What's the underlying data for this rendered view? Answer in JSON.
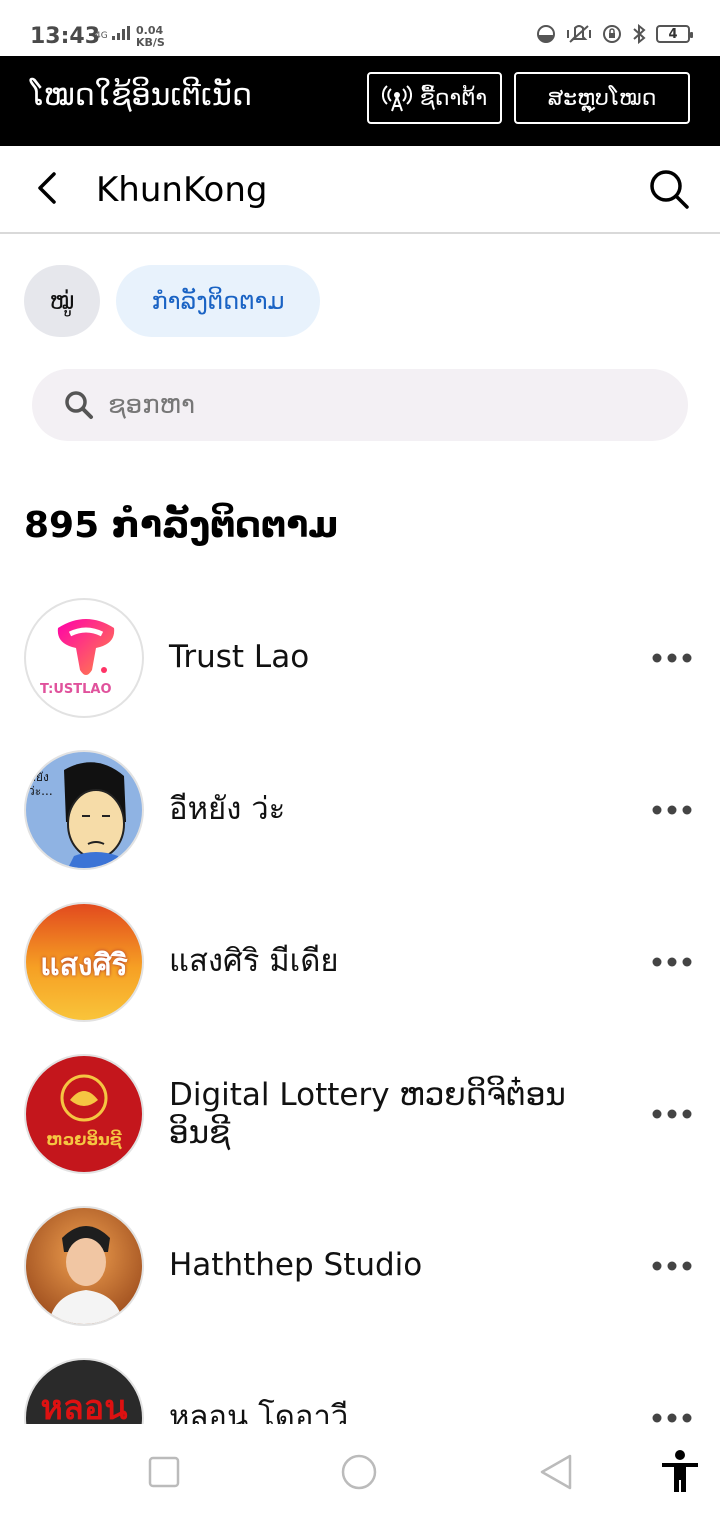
{
  "status_bar": {
    "time": "13:43",
    "network": "4G",
    "speed_value": "0.04",
    "speed_unit": "KB/S",
    "battery": "4"
  },
  "data_banner": {
    "title": "ໂໝດໃຊ້ອິນເຕີເນັດ",
    "buy_data_label": "ຊື້ດາຕ້າ",
    "summary_label": "ສະຫຼຸບໂໝດ"
  },
  "header": {
    "title": "KhunKong"
  },
  "chips": {
    "groups_label": "ໝູ່",
    "following_label": "ກຳລັງຕິດຕາມ"
  },
  "search": {
    "placeholder": "ຊອກຫາ"
  },
  "following_count": "895 ກຳລັງຕິດຕາມ",
  "list": [
    {
      "name": "Trust Lao",
      "avatar_text": "T:USTLAO"
    },
    {
      "name": "อีหยัง ว่ะ",
      "avatar_text": "หยัง ว่ะ..."
    },
    {
      "name": "แสงศิริ มีเดีย",
      "avatar_text": "แสงศิริ"
    },
    {
      "name": "Digital Lottery ຫວຍດິຈິຕ໋ອນ ອິນຊີ",
      "avatar_text": "ຫວຍອິນຊີ"
    },
    {
      "name": "Haththep Studio",
      "avatar_text": ""
    },
    {
      "name": "หลอน โดอาวี",
      "avatar_text": "หลอน"
    }
  ],
  "colors": {
    "banner_bg": "#000000",
    "accent_blue": "#1a63c4",
    "chip_following_bg": "#e8f2fc",
    "chip_groups_bg": "#e6e7ec",
    "search_bg": "#f3f0f4"
  }
}
